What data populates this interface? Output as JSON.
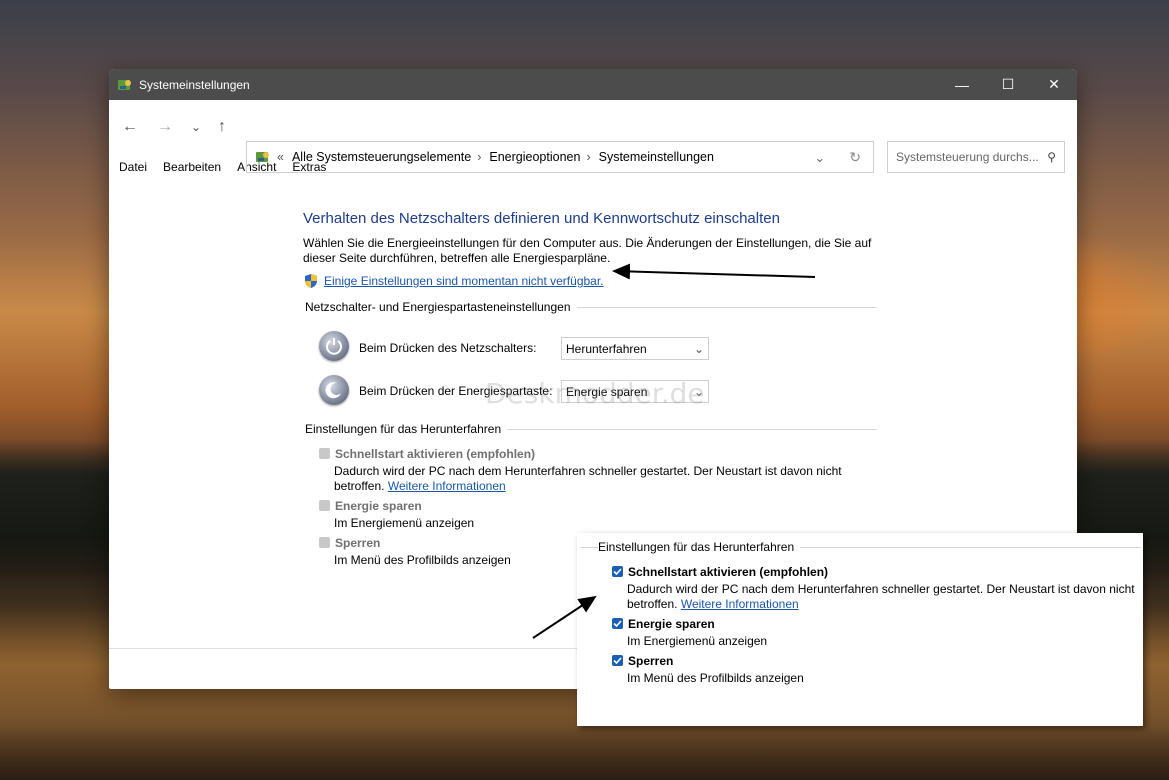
{
  "window": {
    "title": "Systemeinstellungen",
    "controls": {
      "minimize": "—",
      "maximize": "☐",
      "close": "✕"
    }
  },
  "nav": {
    "back": "←",
    "forward": "→",
    "recent": "⌄",
    "up": "↑",
    "prefix": "«",
    "breadcrumb": [
      "Alle Systemsteuerungselemente",
      "Energieoptionen",
      "Systemeinstellungen"
    ],
    "separator": "›",
    "dropdown": "⌄",
    "refresh": "↻",
    "search_placeholder": "Systemsteuerung durchs...",
    "search_icon": "⚲"
  },
  "menu": [
    "Datei",
    "Bearbeiten",
    "Ansicht",
    "Extras"
  ],
  "main": {
    "heading": "Verhalten des Netzschalters definieren und Kennwortschutz einschalten",
    "description": "Wählen Sie die Energieeinstellungen für den Computer aus. Die Änderungen der Einstellungen, die Sie auf dieser Seite durchführen, betreffen alle Energiesparpläne.",
    "admin_link": "Einige Einstellungen sind momentan nicht verfügbar.",
    "power_group_title": "Netzschalter- und Energiespartasteneinstellungen",
    "power_rows": [
      {
        "label": "Beim Drücken des Netzschalters:",
        "value": "Herunterfahren"
      },
      {
        "label": "Beim Drücken der Energiespartaste:",
        "value": "Energie sparen"
      }
    ],
    "shutdown_group_title": "Einstellungen für das Herunterfahren",
    "options": [
      {
        "label": "Schnellstart aktivieren (empfohlen)",
        "desc_line1": "Dadurch wird der PC nach dem Herunterfahren schneller gestartet. Der Neustart ist davon nicht",
        "desc_line2": "betroffen.",
        "link": "Weitere Informationen"
      },
      {
        "label": "Energie sparen",
        "desc_line1": "Im Energiemenü anzeigen"
      },
      {
        "label": "Sperren",
        "desc_line1": "Im Menü des Profilbilds anzeigen"
      }
    ],
    "watermark": "Deskmodder.de"
  },
  "inset": {
    "group_title": "Einstellungen für das Herunterfahren",
    "options": [
      {
        "label": "Schnellstart aktivieren (empfohlen)",
        "checked": true,
        "desc_line1": "Dadurch wird der PC nach dem Herunterfahren schneller gestartet. Der Neustart ist davon nicht",
        "desc_line2": "betroffen.",
        "link": "Weitere Informationen"
      },
      {
        "label": "Energie sparen",
        "checked": true,
        "desc_line1": "Im Energiemenü anzeigen"
      },
      {
        "label": "Sperren",
        "checked": true,
        "desc_line1": "Im Menü des Profilbilds anzeigen"
      }
    ]
  },
  "colors": {
    "heading": "#1e3c8c",
    "link": "#1a56a8",
    "checkbox_on": "#1a5fb4",
    "titlebar": "#4c4c4c"
  }
}
